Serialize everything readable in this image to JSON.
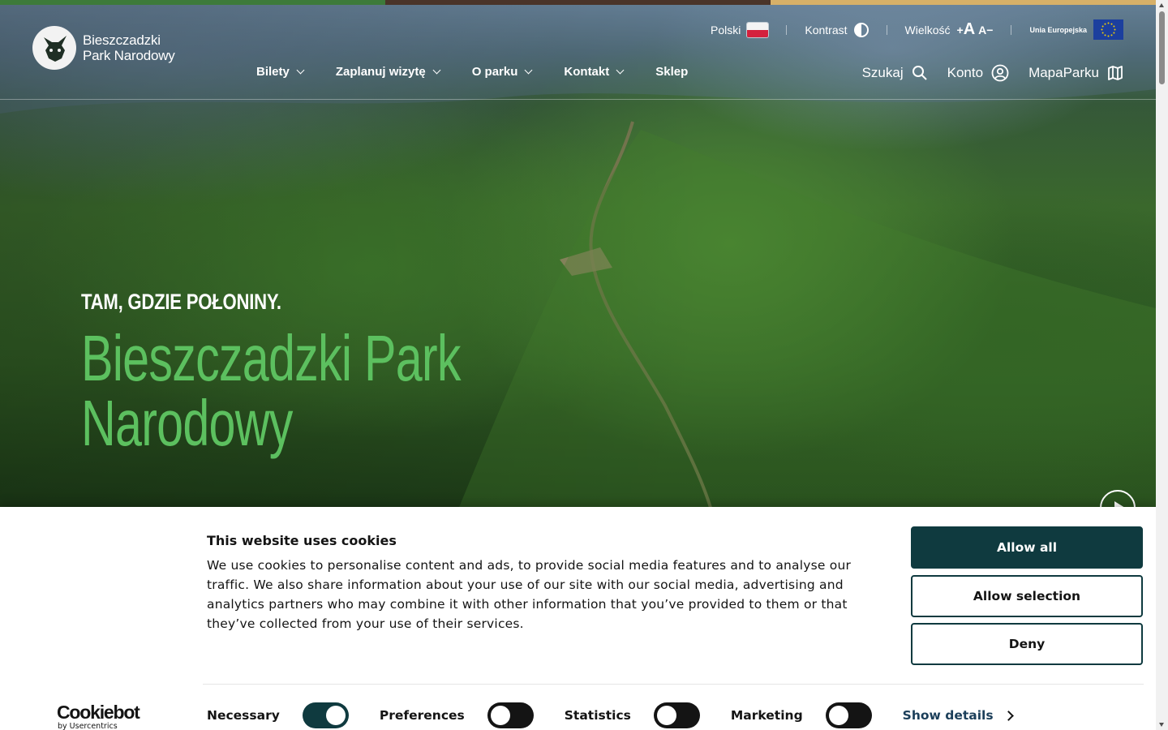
{
  "accent_colors": [
    "#3d7a3a",
    "#4a3429",
    "#d7b068"
  ],
  "header": {
    "logo_line1": "Bieszczadzki",
    "logo_line2": "Park Narodowy",
    "language": "Polski",
    "contrast": "Kontrast",
    "size_label": "Wielkość",
    "size_plus": "+",
    "size_big": "A",
    "size_small": "A",
    "size_minus": "−",
    "eu_label": "Unia Europejska",
    "nav": [
      "Bilety",
      "Zaplanuj wizytę",
      "O parku",
      "Kontakt",
      "Sklep"
    ],
    "search": "Szukaj",
    "account": "Konto",
    "map": "MapaParku"
  },
  "hero": {
    "subtitle": "TAM, GDZIE POŁONINY.",
    "title_line1": "Bieszczadzki Park",
    "title_line2": "Narodowy"
  },
  "cookie": {
    "title": "This website uses cookies",
    "body": "We use cookies to personalise content and ads, to provide social media features and to analyse our traffic. We also share information about your use of our site with our social media, advertising and analytics partners who may combine it with other information that you’ve provided to them or that they’ve collected from your use of their services.",
    "allow_all": "Allow all",
    "allow_selection": "Allow selection",
    "deny": "Deny",
    "brand": "Cookiebot",
    "brand_by": "by Usercentrics",
    "toggles": [
      {
        "label": "Necessary",
        "on": true
      },
      {
        "label": "Preferences",
        "on": false
      },
      {
        "label": "Statistics",
        "on": false
      },
      {
        "label": "Marketing",
        "on": false
      }
    ],
    "show_details": "Show details"
  },
  "colors": {
    "hero_title": "#5cc05f",
    "button_dark": "#0f3a3f"
  }
}
